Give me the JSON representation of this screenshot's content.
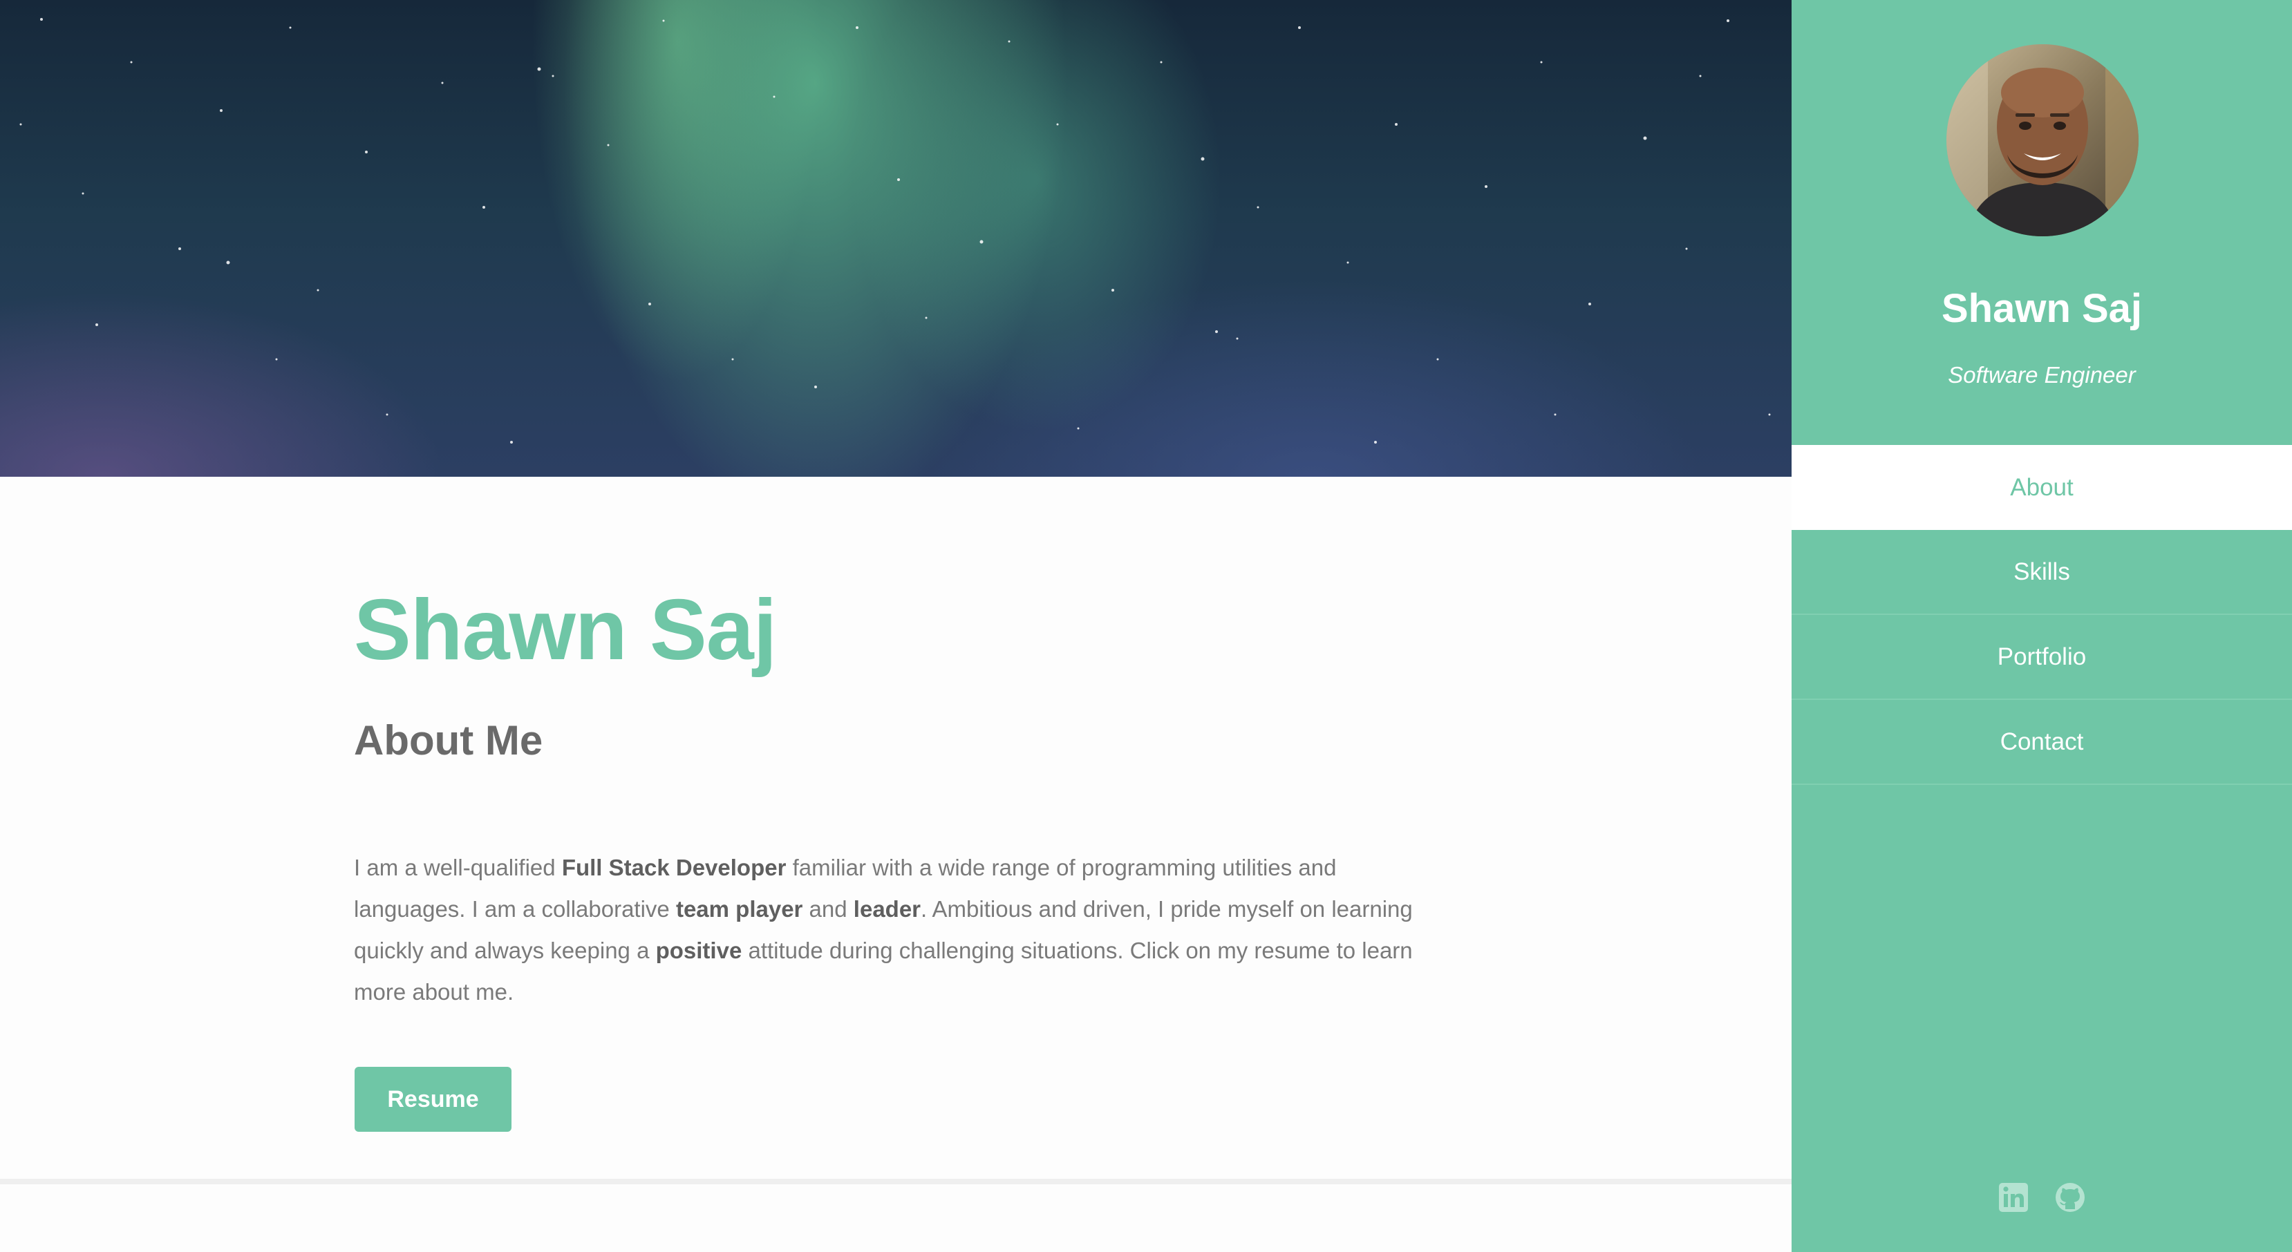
{
  "hero": {
    "image": "northern-lights-night-sky"
  },
  "main": {
    "title": "Shawn Saj",
    "section_heading": "About Me",
    "about": {
      "p1": "I am a well-qualified ",
      "b1": "Full Stack Developer",
      "p2": " familiar with a wide range of programming utilities and languages. I am a collaborative ",
      "b2": "team player",
      "p3": " and ",
      "b3": "leader",
      "p4": ". Ambitious and driven, I pride myself on learning quickly and always keeping a ",
      "b4": "positive",
      "p5": " attitude during challenging situations. Click on my resume to learn more about me."
    },
    "resume_label": "Resume"
  },
  "sidebar": {
    "name": "Shawn Saj",
    "role": "Software Engineer",
    "nav": [
      {
        "label": "About",
        "active": true
      },
      {
        "label": "Skills",
        "active": false
      },
      {
        "label": "Portfolio",
        "active": false
      },
      {
        "label": "Contact",
        "active": false
      }
    ],
    "social": [
      "linkedin-icon",
      "github-icon"
    ]
  },
  "colors": {
    "accent": "#6fc6a6",
    "body_text": "#7a7a7a",
    "heading_text": "#6a6a6a"
  }
}
